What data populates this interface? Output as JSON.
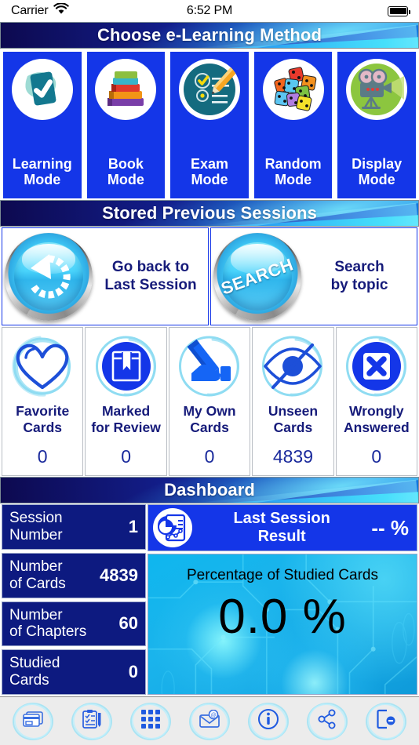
{
  "statusbar": {
    "carrier": "Carrier",
    "wifi_icon": "wifi-icon",
    "time": "6:52 PM",
    "battery_icon": "battery-full-icon"
  },
  "sections": {
    "methods_title": "Choose e-Learning Method",
    "sessions_title": "Stored Previous Sessions",
    "dashboard_title": "Dashboard"
  },
  "modes": [
    {
      "label": "Learning\nMode",
      "label_l1": "Learning",
      "label_l2": "Mode",
      "icon": "flashcard-check-icon"
    },
    {
      "label": "Book\nMode",
      "label_l1": "Book",
      "label_l2": "Mode",
      "icon": "book-stack-icon"
    },
    {
      "label": "Exam\nMode",
      "label_l1": "Exam",
      "label_l2": "Mode",
      "icon": "exam-pencil-icon"
    },
    {
      "label": "Random\nMode",
      "label_l1": "Random",
      "label_l2": "Mode",
      "icon": "dice-icon"
    },
    {
      "label": "Display\nMode",
      "label_l1": "Display",
      "label_l2": "Mode",
      "icon": "movie-camera-icon"
    }
  ],
  "sessions": [
    {
      "label_l1": "Go back to",
      "label_l2": "Last Session",
      "icon": "undo-arrow-icon",
      "button_text": ""
    },
    {
      "label_l1": "Search",
      "label_l2": "by topic",
      "icon": "search-button-icon",
      "button_text": "SEARCH"
    }
  ],
  "categories": [
    {
      "label_l1": "Favorite",
      "label_l2": "Cards",
      "count": "0",
      "icon": "heart-icon"
    },
    {
      "label_l1": "Marked",
      "label_l2": "for Review",
      "count": "0",
      "icon": "bookmark-icon"
    },
    {
      "label_l1": "My Own",
      "label_l2": "Cards",
      "count": "0",
      "icon": "hand-pencil-icon"
    },
    {
      "label_l1": "Unseen",
      "label_l2": "Cards",
      "count": "4839",
      "icon": "eye-slash-icon"
    },
    {
      "label_l1": "Wrongly",
      "label_l2": "Answered",
      "count": "0",
      "icon": "x-cross-icon"
    }
  ],
  "dashboard": {
    "stats": [
      {
        "key_l1": "Session",
        "key_l2": "Number",
        "value": "1"
      },
      {
        "key_l1": "Number",
        "key_l2": "of Cards",
        "value": "4839"
      },
      {
        "key_l1": "Number",
        "key_l2": "of Chapters",
        "value": "60"
      },
      {
        "key_l1": "Studied",
        "key_l2": "Cards",
        "value": "0"
      }
    ],
    "last_session": {
      "title_l1": "Last Session",
      "title_l2": "Result",
      "percent": "-- %",
      "icon": "report-chart-icon"
    },
    "percentage_panel": {
      "title": "Percentage of Studied Cards",
      "value": "0.0 %"
    }
  },
  "toolbar": [
    {
      "name": "cards-icon",
      "label": "Cards"
    },
    {
      "name": "test-clipboard-icon",
      "label": "Test"
    },
    {
      "name": "grid-apps-icon",
      "label": "Apps"
    },
    {
      "name": "mail-icon",
      "label": "Mail"
    },
    {
      "name": "info-icon",
      "label": "Info"
    },
    {
      "name": "share-icon",
      "label": "Share"
    },
    {
      "name": "exit-icon",
      "label": "Exit"
    }
  ],
  "colors": {
    "brand_blue": "#1436e8",
    "navy": "#0d1a80",
    "cyan": "#0fb6ee",
    "label_navy": "#161b7a"
  }
}
